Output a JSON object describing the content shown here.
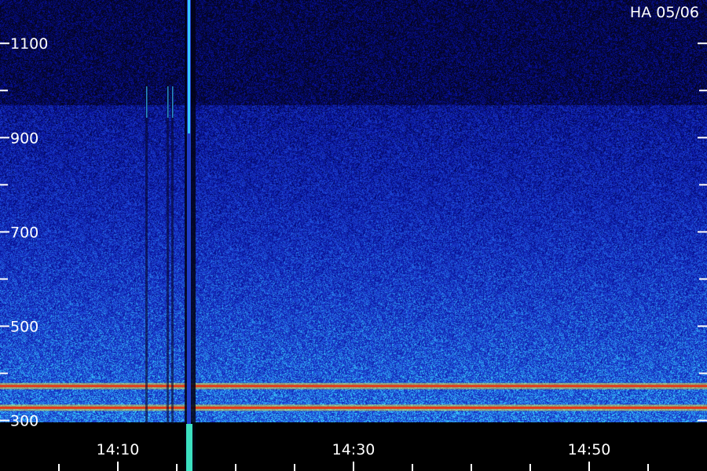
{
  "chart_data": {
    "type": "heatmap",
    "title": "HA 05/06",
    "xlabel": "",
    "ylabel": "",
    "y_tick_labels": [
      "300",
      "500",
      "700",
      "900",
      "1100"
    ],
    "y_values": [
      300,
      500,
      700,
      900,
      1100
    ],
    "y_minor_ticks": [
      400,
      600,
      800,
      1000
    ],
    "ylim": [
      296,
      1192
    ],
    "x_tick_labels": [
      "14:10",
      "14:30",
      "14:50"
    ],
    "x_values_min": [
      10,
      30,
      50
    ],
    "x_minor_ticks_min": [
      5,
      15,
      20,
      25,
      35,
      40,
      45,
      55
    ],
    "xlim_min": [
      0,
      60
    ],
    "grid": false,
    "colormap": "dark blue to cyan noise, red/yellow for strong emission",
    "features": {
      "dark_band_mhz": [
        970,
        1192
      ],
      "vertical_burst_min": 16,
      "weak_vertical_lines_min": [
        12.4,
        14.2,
        14.6
      ],
      "interference_lines_mhz": [
        373,
        327
      ]
    },
    "colors": {
      "background": "#000000",
      "low": "#06062e",
      "mid": "#1e3cc8",
      "high": "#35c8ff",
      "peak_red": "#e23a1a",
      "peak_yellow": "#e8e040",
      "label": "#ffffff"
    }
  }
}
